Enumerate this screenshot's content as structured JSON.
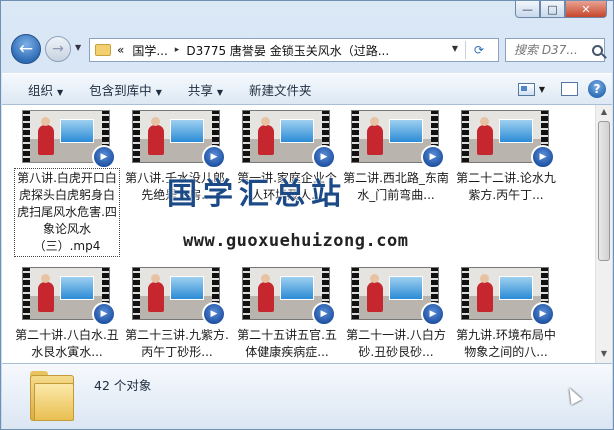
{
  "window": {
    "caption_buttons": {
      "minimize": "—",
      "maximize": "□",
      "close": "✕"
    }
  },
  "address": {
    "overflow": "«",
    "crumbs": [
      "国学...",
      "D3775 唐誉晏 金锁玉关风水（过路..."
    ],
    "separator": "▸"
  },
  "search": {
    "placeholder": "搜索 D37..."
  },
  "toolbar": {
    "organize": "组织",
    "include_in_library": "包含到库中",
    "share": "共享",
    "new_folder": "新建文件夹"
  },
  "files": [
    {
      "label": "第八讲.白虎开口白虎探头白虎躬身白虎扫尾风水危害.四象论风水（三）.mp4",
      "selected": true
    },
    {
      "label": "第八讲.壬水没儿郎.先绝是二房..."
    },
    {
      "label": "第一讲.家庭企业个人环境及人..."
    },
    {
      "label": "第二讲.西北路_东南水_门前弯曲..."
    },
    {
      "label": "第二十二讲.论水九紫方.丙午丁..."
    },
    {
      "label": "第二十讲.八白水.丑水艮水寅水..."
    },
    {
      "label": "第二十三讲.九紫方.丙午丁砂形..."
    },
    {
      "label": "第二十五讲五官.五体健康疾病症..."
    },
    {
      "label": "第二十一讲.八白方砂.丑砂艮砂..."
    },
    {
      "label": "第九讲.环境布局中物象之间的八..."
    }
  ],
  "watermark": {
    "title": "国学汇总站",
    "url": "www.guoxuehuizong.com"
  },
  "status": {
    "count": "42 个对象"
  }
}
